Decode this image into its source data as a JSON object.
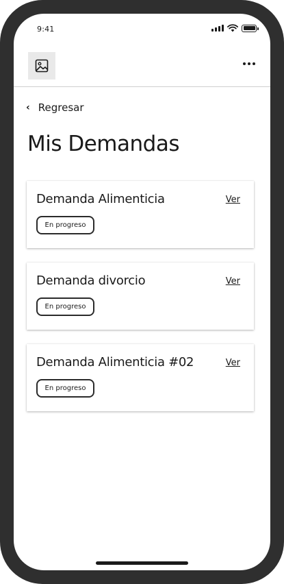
{
  "status_bar": {
    "time": "9:41"
  },
  "header": {
    "more_label": "..."
  },
  "nav": {
    "back_label": "Regresar"
  },
  "page": {
    "title": "Mis Demandas"
  },
  "demands": [
    {
      "title": "Demanda Alimenticia",
      "action": "Ver",
      "status": "En progreso"
    },
    {
      "title": "Demanda divorcio",
      "action": "Ver",
      "status": "En progreso"
    },
    {
      "title": "Demanda Alimenticia #02",
      "action": "Ver",
      "status": "En progreso"
    }
  ]
}
